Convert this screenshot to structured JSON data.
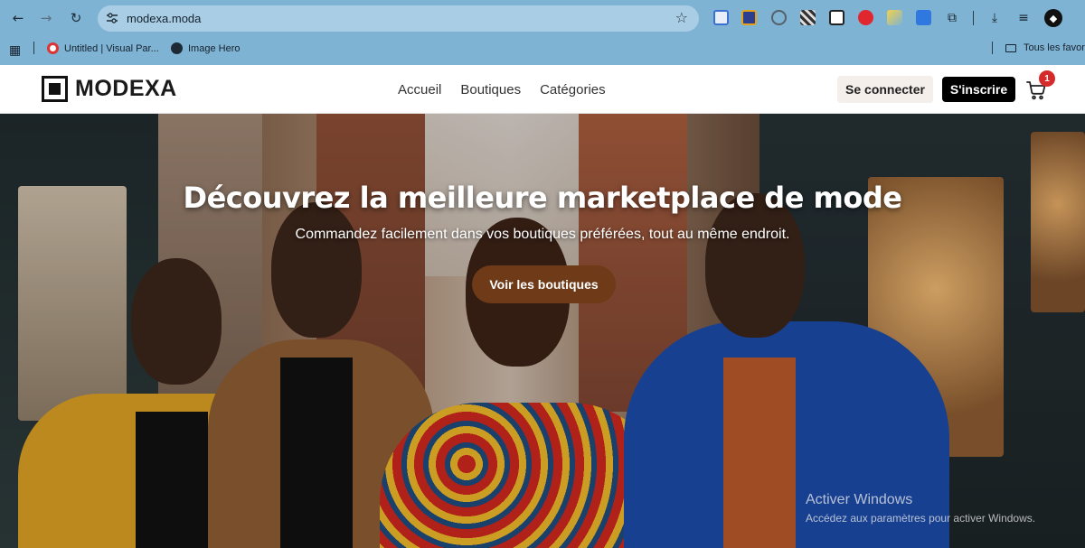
{
  "browser": {
    "url": "modexa.moda",
    "bookmarks": [
      {
        "label": "Untitled | Visual Par..."
      },
      {
        "label": "Image Hero"
      }
    ],
    "bookmarks_folder": "Tous les favoris"
  },
  "header": {
    "logo_text": "MODEXA",
    "nav": [
      {
        "label": "Accueil"
      },
      {
        "label": "Boutiques"
      },
      {
        "label": "Catégories"
      }
    ],
    "login_label": "Se connecter",
    "signup_label": "S'inscrire",
    "cart_count": "1"
  },
  "hero": {
    "title": "Découvrez la meilleure marketplace de mode",
    "subtitle": "Commandez facilement dans vos boutiques préférées, tout au même endroit.",
    "cta_label": "Voir les boutiques"
  },
  "watermark": {
    "line1": "Activer Windows",
    "line2": "Accédez aux paramètres pour activer Windows."
  },
  "colors": {
    "chrome_bg": "#7fb3d3",
    "cta": "#6e3a17",
    "badge": "#d42a2a"
  }
}
